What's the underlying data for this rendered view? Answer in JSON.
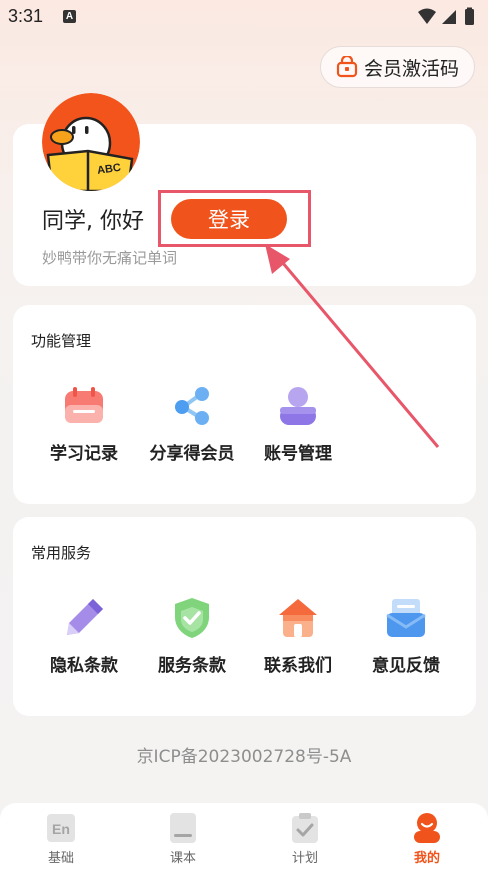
{
  "status_bar": {
    "time": "3:31",
    "notification_letter": "A"
  },
  "header": {
    "vip_code_label": "会员激活码"
  },
  "profile": {
    "greeting": "同学, 你好",
    "subtitle": "妙鸭带你无痛记单词",
    "login_label": "登录",
    "avatar_book_text": "ABC"
  },
  "function_section": {
    "title": "功能管理",
    "items": [
      {
        "label": "学习记录",
        "icon": "calendar-icon"
      },
      {
        "label": "分享得会员",
        "icon": "share-icon"
      },
      {
        "label": "账号管理",
        "icon": "user-icon"
      }
    ]
  },
  "service_section": {
    "title": "常用服务",
    "items": [
      {
        "label": "隐私条款",
        "icon": "pencil-icon"
      },
      {
        "label": "服务条款",
        "icon": "shield-check-icon"
      },
      {
        "label": "联系我们",
        "icon": "house-icon"
      },
      {
        "label": "意见反馈",
        "icon": "mail-icon"
      }
    ]
  },
  "footer": {
    "icp": "京ICP备2023002728号-5A"
  },
  "bottom_nav": {
    "items": [
      {
        "label": "基础",
        "icon": "en-icon"
      },
      {
        "label": "课本",
        "icon": "book-icon"
      },
      {
        "label": "计划",
        "icon": "clipboard-icon"
      },
      {
        "label": "我的",
        "icon": "profile-icon"
      }
    ],
    "active_index": 3
  },
  "colors": {
    "accent": "#f0541c",
    "highlight": "#e8566a"
  }
}
